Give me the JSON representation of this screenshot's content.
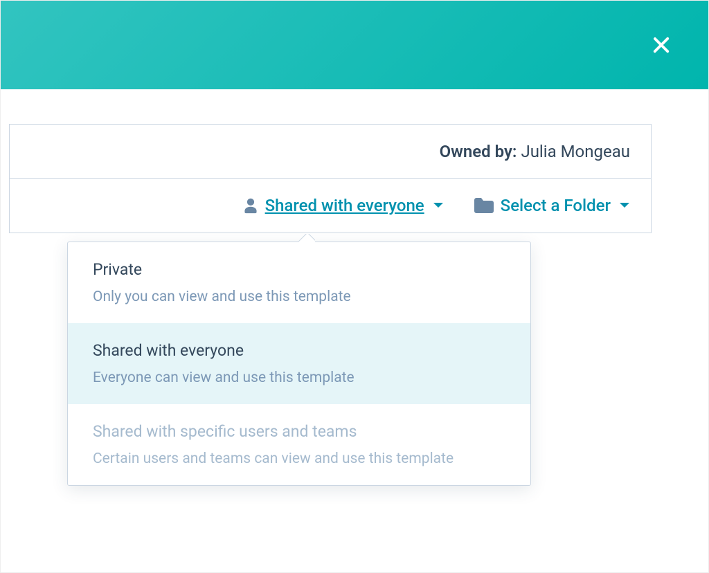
{
  "owner": {
    "label": "Owned by:",
    "name": "Julia Mongeau"
  },
  "controls": {
    "sharing": {
      "icon": "person-icon",
      "label": "Shared with everyone"
    },
    "folder": {
      "icon": "folder-icon",
      "label": "Select a Folder"
    }
  },
  "sharing_options": [
    {
      "title": "Private",
      "description": "Only you can view and use this template",
      "selected": false,
      "disabled": false
    },
    {
      "title": "Shared with everyone",
      "description": "Everyone can view and use this template",
      "selected": true,
      "disabled": false
    },
    {
      "title": "Shared with specific users and teams",
      "description": "Certain users and teams can view and use this template",
      "selected": false,
      "disabled": true
    }
  ]
}
